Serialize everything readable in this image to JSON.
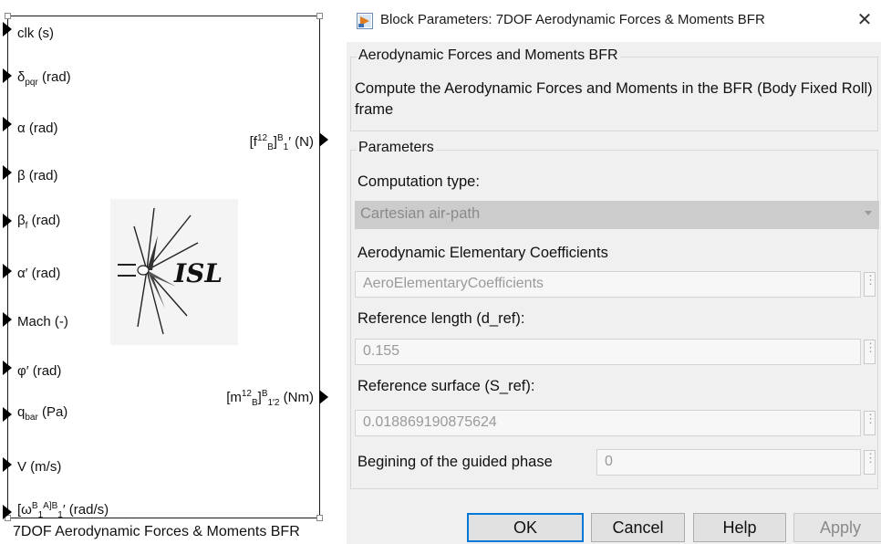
{
  "block": {
    "name": "7DOF Aerodynamic Forces & Moments BFR",
    "inputs": {
      "clk": "clk (s)",
      "delta_base": "δ",
      "delta_sub": "pqr",
      "delta_unit": " (rad)",
      "alpha": "α (rad)",
      "beta": "β (rad)",
      "betaf_base": "β",
      "betaf_sub": "f",
      "betaf_unit": " (rad)",
      "alphap": "α′ (rad)",
      "mach": "Mach (-)",
      "phip": "φ′ (rad)",
      "qbar_base": "q",
      "qbar_sub": "bar",
      "qbar_unit": " (Pa)",
      "v": "V (m/s)",
      "omega_pre": "[ω",
      "omega_sup1": "B",
      "omega_sub1": "1",
      "omega_sup2": "A",
      "omega_sup3": "]",
      "omega_sup4": "B",
      "omega_sub2": "1",
      "omega_unit": "′ (rad/s)"
    },
    "outputs": {
      "force_pre": "[f",
      "force_sup1": "12",
      "force_sub1": "B",
      "force_mid": "]",
      "force_sup2": "B",
      "force_sub2": "1",
      "force_unit": "′ (N)",
      "moment_pre": "[m",
      "moment_sup1": "12",
      "moment_sub1": "B",
      "moment_mid": "]",
      "moment_sup2": "B",
      "moment_sub2": "1′2",
      "moment_unit": " (Nm)"
    },
    "logo_text": "ISL"
  },
  "dialog": {
    "title": "Block Parameters: 7DOF Aerodynamic Forces & Moments BFR",
    "close_glyph": "✕",
    "group1_title": "Aerodynamic Forces and Moments BFR",
    "description": "Compute the Aerodynamic Forces and Moments in the BFR (Body Fixed Roll) frame",
    "group2_title": "Parameters",
    "computation_type_label": "Computation type:",
    "computation_type_value": "Cartesian air-path",
    "coefficients_label": "Aerodynamic Elementary Coefficients",
    "coefficients_value": "AeroElementaryCoefficients",
    "ref_length_label": "Reference length (d_ref):",
    "ref_length_value": "0.155",
    "ref_surface_label": "Reference surface (S_ref):",
    "ref_surface_value": "0.018869190875624",
    "guided_label": "Begining of the guided phase",
    "guided_value": "0",
    "dots_glyph": "⋮",
    "buttons": {
      "ok": "OK",
      "cancel": "Cancel",
      "help": "Help",
      "apply": "Apply"
    }
  },
  "colors": {
    "accent": "#0078d7",
    "dialog_bg": "#f0f0f0",
    "disabled_text": "#9a9a9a"
  }
}
